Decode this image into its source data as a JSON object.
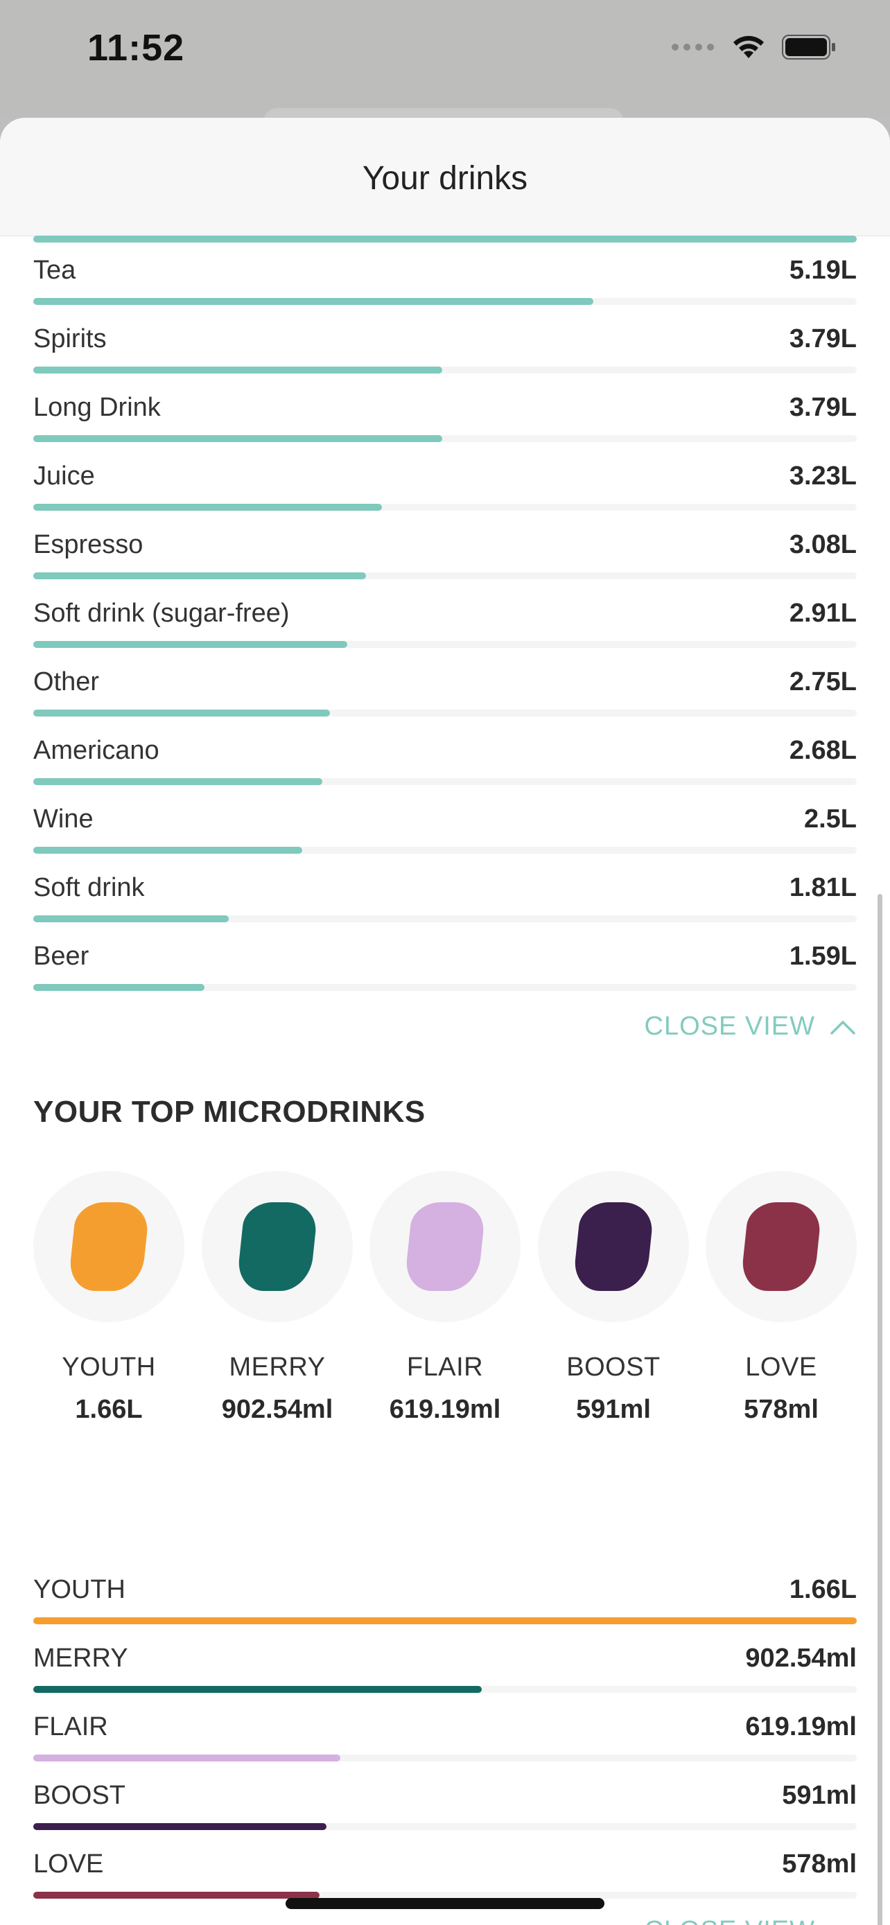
{
  "status_bar": {
    "time": "11:52"
  },
  "header": {
    "title": "Your drinks"
  },
  "colors": {
    "accent": "#7fc9bd",
    "track": "#f4f4f4",
    "youth": "#f59e30",
    "merry": "#136a62",
    "flair": "#d4b1e0",
    "boost": "#3b1f4d",
    "love": "#8c3248"
  },
  "drinks": {
    "items": [
      {
        "label": "Tea",
        "value": "5.19L",
        "fraction": 0.68
      },
      {
        "label": "Spirits",
        "value": "3.79L",
        "fraction": 0.497
      },
      {
        "label": "Long Drink",
        "value": "3.79L",
        "fraction": 0.497
      },
      {
        "label": "Juice",
        "value": "3.23L",
        "fraction": 0.423
      },
      {
        "label": "Espresso",
        "value": "3.08L",
        "fraction": 0.404
      },
      {
        "label": "Soft drink (sugar-free)",
        "value": "2.91L",
        "fraction": 0.381
      },
      {
        "label": "Other",
        "value": "2.75L",
        "fraction": 0.36
      },
      {
        "label": "Americano",
        "value": "2.68L",
        "fraction": 0.351
      },
      {
        "label": "Wine",
        "value": "2.5L",
        "fraction": 0.327
      },
      {
        "label": "Soft drink",
        "value": "1.81L",
        "fraction": 0.237
      },
      {
        "label": "Beer",
        "value": "1.59L",
        "fraction": 0.208
      }
    ],
    "close_view_label": "CLOSE VIEW"
  },
  "microdrinks": {
    "title": "YOUR TOP MICRODRINKS",
    "cards": [
      {
        "name": "YOUTH",
        "amount": "1.66L",
        "color": "#f59e30"
      },
      {
        "name": "MERRY",
        "amount": "902.54ml",
        "color": "#136a62"
      },
      {
        "name": "FLAIR",
        "amount": "619.19ml",
        "color": "#d4b1e0"
      },
      {
        "name": "BOOST",
        "amount": "591ml",
        "color": "#3b1f4d"
      },
      {
        "name": "LOVE",
        "amount": "578ml",
        "color": "#8c3248"
      }
    ],
    "items": [
      {
        "label": "YOUTH",
        "value": "1.66L",
        "fraction": 1.0,
        "color": "#f59e30"
      },
      {
        "label": "MERRY",
        "value": "902.54ml",
        "fraction": 0.545,
        "color": "#136a62"
      },
      {
        "label": "FLAIR",
        "value": "619.19ml",
        "fraction": 0.373,
        "color": "#d4b1e0"
      },
      {
        "label": "BOOST",
        "value": "591ml",
        "fraction": 0.356,
        "color": "#3b1f4d"
      },
      {
        "label": "LOVE",
        "value": "578ml",
        "fraction": 0.348,
        "color": "#8c3248"
      }
    ],
    "close_view_label": "CLOSE VIEW"
  }
}
